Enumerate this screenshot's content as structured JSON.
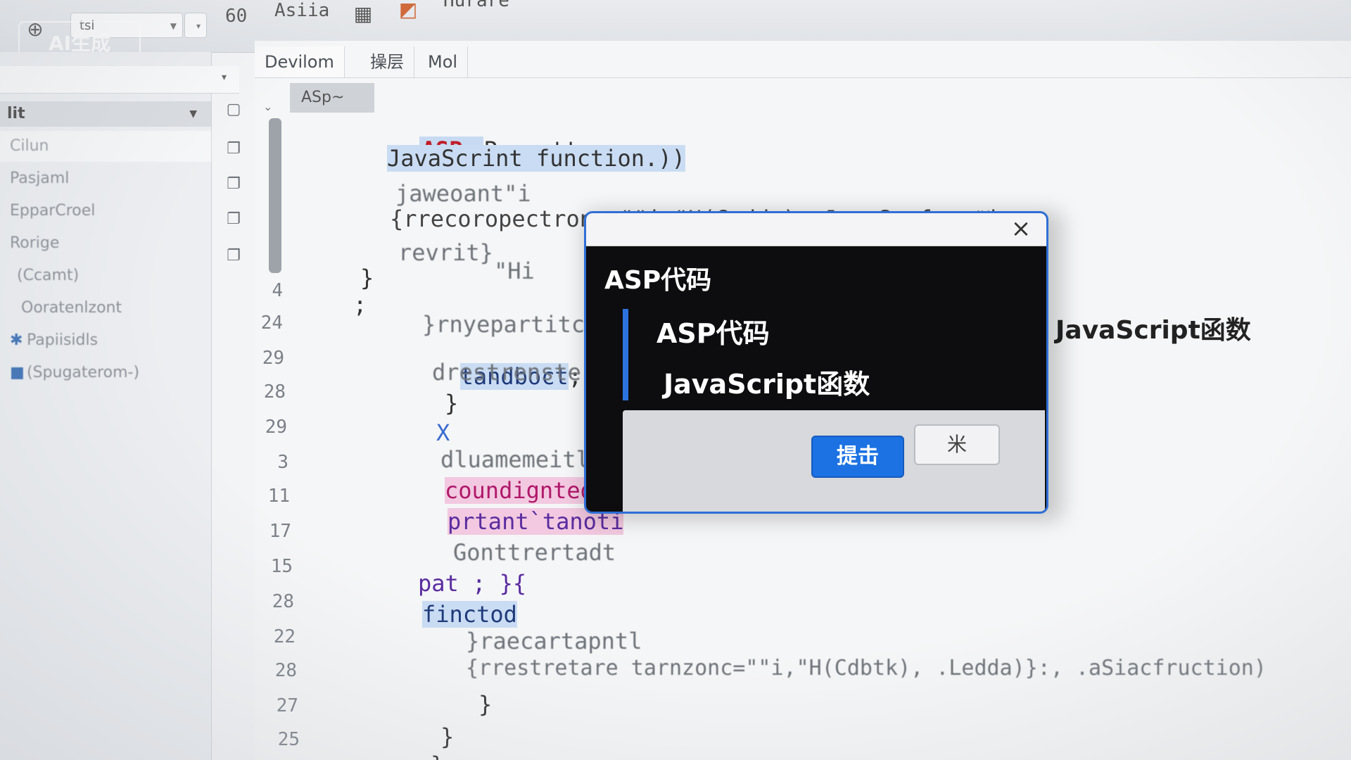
{
  "watermark": "AI生成",
  "toolbar": {
    "combo_value": "tsl",
    "text_60": "60",
    "text_asia": "Asiia",
    "menu_partial": "Hurare"
  },
  "sidebar": {
    "header": "lit",
    "items": [
      {
        "label": "Cilun",
        "selected": true
      },
      {
        "label": "Pasjaml",
        "selected": false
      },
      {
        "label": "EpparCroel",
        "selected": false
      },
      {
        "label": "Rorige",
        "selected": false
      },
      {
        "label": "(Ccamt)",
        "selected": false
      },
      {
        "label": "Ooratenlzont",
        "selected": false
      },
      {
        "label": "Papiisidls",
        "selected": false
      },
      {
        "label": "(Spugaterom-)",
        "selected": false
      }
    ]
  },
  "editor": {
    "tabs": [
      "Devilom",
      "操层",
      "Mol"
    ],
    "file_tab": "ASp~",
    "line_numbers": [
      "4",
      "24",
      "29",
      "28",
      "29",
      "3",
      "11",
      "17",
      "15",
      "28",
      "22",
      "28",
      "27",
      "25"
    ],
    "code": {
      "l1_kw": "ASP",
      "l1_rest": "Prrpptt",
      "l2": "JavaScrint function.))",
      "l3": "jaweoant\"i",
      "l4": "{rrecoropectroncs\"\"i,\"H(Caddv), JavaScrfunction",
      "l5": "revrit}",
      "l6": "\"Hi",
      "l7": "}",
      "l8": ";",
      "l9": "}rnyepartitc",
      "l10": "tandboct",
      "l10_rest": ";",
      "l11": "drestrenste",
      "l12": "}",
      "l13": "X",
      "l14": "dluamemeitle",
      "l15": "coundigntedi(",
      "l16": "prtant`tanoti",
      "l17": "Gonttrertadt",
      "l18": "pat ; }{",
      "l19": "finctod",
      "l20": "}raecartapntl",
      "l21": "{rrestretare tarnzonc=\"\"i,\"H(Cdbtk), .Ledda)}:, .aSiacfruction)",
      "l22": "}",
      "l23": "}",
      "l24": "}"
    }
  },
  "dialog": {
    "title": "ASP代码",
    "line1": "ASP代码",
    "line2": "JavaScript函数",
    "submit_label": "提击",
    "cancel_label": "米",
    "close_glyph": "×"
  },
  "side_label": "JavaScript函数",
  "colors": {
    "accent": "#1c72e3",
    "dialog_bg": "#0d0d0f",
    "asp_keyword": "#c01c28"
  },
  "icons": {
    "globe": "globe-icon",
    "grid": "grid-icon",
    "close": "close-icon"
  }
}
